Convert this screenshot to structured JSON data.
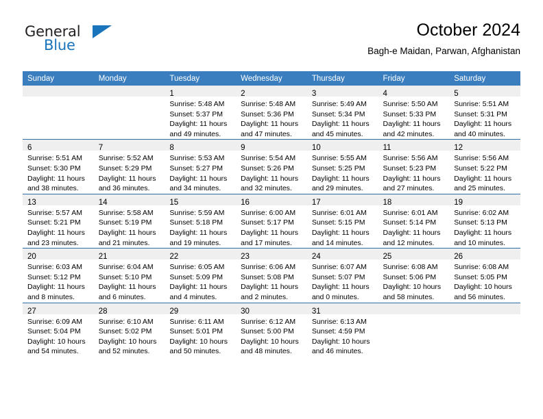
{
  "logo": {
    "word_dark": "General",
    "word_blue": "Blue",
    "triangle_icon": "logo-triangle-icon",
    "color_dark": "#231f20",
    "color_blue": "#1a74bb"
  },
  "header": {
    "title": "October 2024",
    "subtitle": "Bagh-e Maidan, Parwan, Afghanistan"
  },
  "theme": {
    "header_blue": "#3a7ebf",
    "row_divider_blue": "#2e6da4",
    "daynum_band_gray": "#efefef"
  },
  "weekday_headers": [
    "Sunday",
    "Monday",
    "Tuesday",
    "Wednesday",
    "Thursday",
    "Friday",
    "Saturday"
  ],
  "weeks": [
    [
      {
        "day": "",
        "lines": []
      },
      {
        "day": "",
        "lines": []
      },
      {
        "day": "1",
        "lines": [
          "Sunrise: 5:48 AM",
          "Sunset: 5:37 PM",
          "Daylight: 11 hours",
          "and 49 minutes."
        ]
      },
      {
        "day": "2",
        "lines": [
          "Sunrise: 5:48 AM",
          "Sunset: 5:36 PM",
          "Daylight: 11 hours",
          "and 47 minutes."
        ]
      },
      {
        "day": "3",
        "lines": [
          "Sunrise: 5:49 AM",
          "Sunset: 5:34 PM",
          "Daylight: 11 hours",
          "and 45 minutes."
        ]
      },
      {
        "day": "4",
        "lines": [
          "Sunrise: 5:50 AM",
          "Sunset: 5:33 PM",
          "Daylight: 11 hours",
          "and 42 minutes."
        ]
      },
      {
        "day": "5",
        "lines": [
          "Sunrise: 5:51 AM",
          "Sunset: 5:31 PM",
          "Daylight: 11 hours",
          "and 40 minutes."
        ]
      }
    ],
    [
      {
        "day": "6",
        "lines": [
          "Sunrise: 5:51 AM",
          "Sunset: 5:30 PM",
          "Daylight: 11 hours",
          "and 38 minutes."
        ]
      },
      {
        "day": "7",
        "lines": [
          "Sunrise: 5:52 AM",
          "Sunset: 5:29 PM",
          "Daylight: 11 hours",
          "and 36 minutes."
        ]
      },
      {
        "day": "8",
        "lines": [
          "Sunrise: 5:53 AM",
          "Sunset: 5:27 PM",
          "Daylight: 11 hours",
          "and 34 minutes."
        ]
      },
      {
        "day": "9",
        "lines": [
          "Sunrise: 5:54 AM",
          "Sunset: 5:26 PM",
          "Daylight: 11 hours",
          "and 32 minutes."
        ]
      },
      {
        "day": "10",
        "lines": [
          "Sunrise: 5:55 AM",
          "Sunset: 5:25 PM",
          "Daylight: 11 hours",
          "and 29 minutes."
        ]
      },
      {
        "day": "11",
        "lines": [
          "Sunrise: 5:56 AM",
          "Sunset: 5:23 PM",
          "Daylight: 11 hours",
          "and 27 minutes."
        ]
      },
      {
        "day": "12",
        "lines": [
          "Sunrise: 5:56 AM",
          "Sunset: 5:22 PM",
          "Daylight: 11 hours",
          "and 25 minutes."
        ]
      }
    ],
    [
      {
        "day": "13",
        "lines": [
          "Sunrise: 5:57 AM",
          "Sunset: 5:21 PM",
          "Daylight: 11 hours",
          "and 23 minutes."
        ]
      },
      {
        "day": "14",
        "lines": [
          "Sunrise: 5:58 AM",
          "Sunset: 5:19 PM",
          "Daylight: 11 hours",
          "and 21 minutes."
        ]
      },
      {
        "day": "15",
        "lines": [
          "Sunrise: 5:59 AM",
          "Sunset: 5:18 PM",
          "Daylight: 11 hours",
          "and 19 minutes."
        ]
      },
      {
        "day": "16",
        "lines": [
          "Sunrise: 6:00 AM",
          "Sunset: 5:17 PM",
          "Daylight: 11 hours",
          "and 17 minutes."
        ]
      },
      {
        "day": "17",
        "lines": [
          "Sunrise: 6:01 AM",
          "Sunset: 5:15 PM",
          "Daylight: 11 hours",
          "and 14 minutes."
        ]
      },
      {
        "day": "18",
        "lines": [
          "Sunrise: 6:01 AM",
          "Sunset: 5:14 PM",
          "Daylight: 11 hours",
          "and 12 minutes."
        ]
      },
      {
        "day": "19",
        "lines": [
          "Sunrise: 6:02 AM",
          "Sunset: 5:13 PM",
          "Daylight: 11 hours",
          "and 10 minutes."
        ]
      }
    ],
    [
      {
        "day": "20",
        "lines": [
          "Sunrise: 6:03 AM",
          "Sunset: 5:12 PM",
          "Daylight: 11 hours",
          "and 8 minutes."
        ]
      },
      {
        "day": "21",
        "lines": [
          "Sunrise: 6:04 AM",
          "Sunset: 5:10 PM",
          "Daylight: 11 hours",
          "and 6 minutes."
        ]
      },
      {
        "day": "22",
        "lines": [
          "Sunrise: 6:05 AM",
          "Sunset: 5:09 PM",
          "Daylight: 11 hours",
          "and 4 minutes."
        ]
      },
      {
        "day": "23",
        "lines": [
          "Sunrise: 6:06 AM",
          "Sunset: 5:08 PM",
          "Daylight: 11 hours",
          "and 2 minutes."
        ]
      },
      {
        "day": "24",
        "lines": [
          "Sunrise: 6:07 AM",
          "Sunset: 5:07 PM",
          "Daylight: 11 hours",
          "and 0 minutes."
        ]
      },
      {
        "day": "25",
        "lines": [
          "Sunrise: 6:08 AM",
          "Sunset: 5:06 PM",
          "Daylight: 10 hours",
          "and 58 minutes."
        ]
      },
      {
        "day": "26",
        "lines": [
          "Sunrise: 6:08 AM",
          "Sunset: 5:05 PM",
          "Daylight: 10 hours",
          "and 56 minutes."
        ]
      }
    ],
    [
      {
        "day": "27",
        "lines": [
          "Sunrise: 6:09 AM",
          "Sunset: 5:04 PM",
          "Daylight: 10 hours",
          "and 54 minutes."
        ]
      },
      {
        "day": "28",
        "lines": [
          "Sunrise: 6:10 AM",
          "Sunset: 5:02 PM",
          "Daylight: 10 hours",
          "and 52 minutes."
        ]
      },
      {
        "day": "29",
        "lines": [
          "Sunrise: 6:11 AM",
          "Sunset: 5:01 PM",
          "Daylight: 10 hours",
          "and 50 minutes."
        ]
      },
      {
        "day": "30",
        "lines": [
          "Sunrise: 6:12 AM",
          "Sunset: 5:00 PM",
          "Daylight: 10 hours",
          "and 48 minutes."
        ]
      },
      {
        "day": "31",
        "lines": [
          "Sunrise: 6:13 AM",
          "Sunset: 4:59 PM",
          "Daylight: 10 hours",
          "and 46 minutes."
        ]
      },
      {
        "day": "",
        "lines": []
      },
      {
        "day": "",
        "lines": []
      }
    ]
  ]
}
